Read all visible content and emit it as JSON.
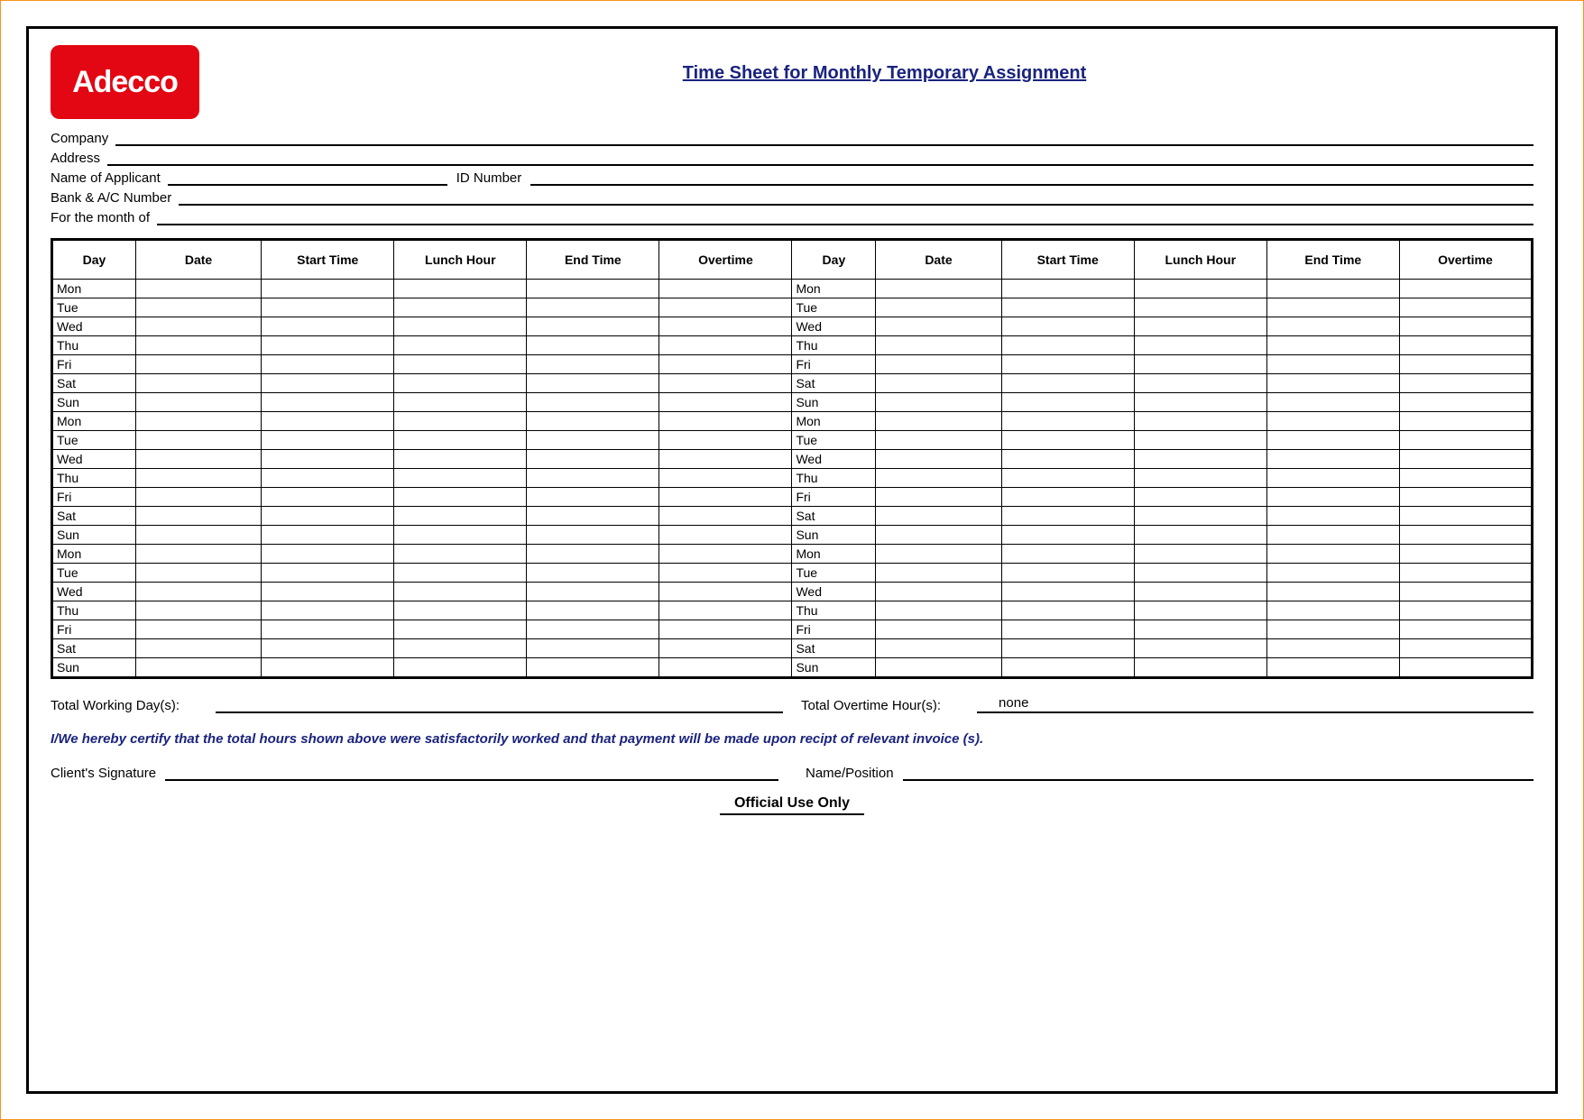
{
  "logo_text": "Adecco",
  "title": "Time Sheet for Monthly Temporary Assignment",
  "fields": {
    "company": "Company",
    "address": "Address",
    "applicant": "Name of Applicant",
    "id_number": "ID Number",
    "bank": "Bank & A/C Number",
    "month": "For the month of"
  },
  "headers": {
    "day": "Day",
    "date": "Date",
    "start": "Start Time",
    "lunch": "Lunch Hour",
    "end": "End Time",
    "overtime": "Overtime"
  },
  "days_left": [
    "Mon",
    "Tue",
    "Wed",
    "Thu",
    "Fri",
    "Sat",
    "Sun",
    "Mon",
    "Tue",
    "Wed",
    "Thu",
    "Fri",
    "Sat",
    "Sun",
    "Mon",
    "Tue",
    "Wed",
    "Thu",
    "Fri",
    "Sat",
    "Sun"
  ],
  "days_right": [
    "Mon",
    "Tue",
    "Wed",
    "Thu",
    "Fri",
    "Sat",
    "Sun",
    "Mon",
    "Tue",
    "Wed",
    "Thu",
    "Fri",
    "Sat",
    "Sun",
    "Mon",
    "Tue",
    "Wed",
    "Thu",
    "Fri",
    "Sat",
    "Sun"
  ],
  "totals": {
    "working_days_label": "Total Working Day(s):",
    "working_days_value": "",
    "overtime_label": "Total Overtime Hour(s):",
    "overtime_value": "none"
  },
  "certification": "I/We hereby certify that the total hours shown above were satisfactorily worked and that payment will be made upon recipt of relevant invoice (s).",
  "signature": {
    "client": "Client's Signature",
    "name_position": "Name/Position"
  },
  "official": "Official Use Only"
}
